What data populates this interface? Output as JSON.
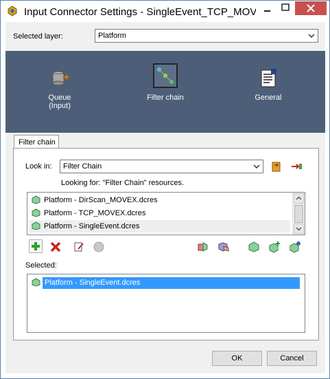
{
  "window": {
    "title": "Input Connector Settings - SingleEvent_TCP_MOVEX"
  },
  "layer": {
    "label": "Selected layer:",
    "value": "Platform"
  },
  "nav": {
    "items": [
      {
        "label_line1": "Queue",
        "label_line2": "(Input)"
      },
      {
        "label_line1": "Filter chain",
        "label_line2": ""
      },
      {
        "label_line1": "General",
        "label_line2": ""
      }
    ]
  },
  "tabs": {
    "filter_chain": "Filter chain"
  },
  "lookin": {
    "label": "Look in:",
    "value": "Filter Chain",
    "looking_for": "Looking for: \"Filter Chain\" resources."
  },
  "resources": {
    "items": [
      "Platform - DirScan_MOVEX.dcres",
      "Platform - TCP_MOVEX.dcres",
      "Platform - SingleEvent.dcres"
    ]
  },
  "selected": {
    "label": "Selected:",
    "items": [
      "Platform - SingleEvent.dcres"
    ]
  },
  "buttons": {
    "ok": "OK",
    "cancel": "Cancel"
  },
  "colors": {
    "nav_bg": "#4d5f78",
    "selection": "#3399ff",
    "close_button": "#c75050"
  }
}
